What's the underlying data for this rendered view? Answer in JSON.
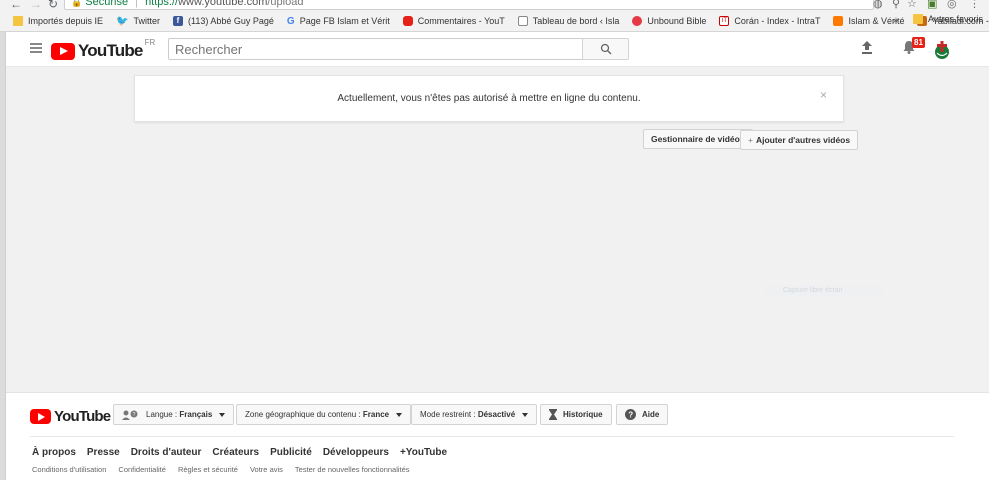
{
  "browser": {
    "secure_label": "Sécurisé",
    "url_scheme": "https://",
    "url_host": "www.youtube.com",
    "url_path": "/upload",
    "back_icon": "arrow-left-icon",
    "forward_icon": "arrow-right-icon",
    "reload_icon": "reload-icon"
  },
  "bookmarks": {
    "items": [
      {
        "label": "Importés depuis IE",
        "icon": "folder-icon"
      },
      {
        "label": "Twitter",
        "icon": "twitter-icon"
      },
      {
        "label": "(113) Abbé Guy Pagé",
        "icon": "facebook-icon"
      },
      {
        "label": "Page FB Islam et Vérit",
        "icon": "google-icon"
      },
      {
        "label": "Commentaires - YouT",
        "icon": "youtube-icon"
      },
      {
        "label": "Tableau de bord ‹ Isla",
        "icon": "page-icon"
      },
      {
        "label": "Unbound Bible",
        "icon": "unbound-bible-icon"
      },
      {
        "label": "Corán - Index - IntraT",
        "icon": "coran-icon"
      },
      {
        "label": "Islam & Vérité",
        "icon": "orange-icon"
      },
      {
        "label": "Yabiladi.com - Le Ma",
        "icon": "yabiladi-icon"
      }
    ],
    "more": "»",
    "others": "Autres favoris"
  },
  "masthead": {
    "logo_text": "YouTube",
    "country": "FR",
    "search_placeholder": "Rechercher",
    "notification_count": "81"
  },
  "main": {
    "alert_text": "Actuellement, vous n'êtes pas autorisé à mettre en ligne du contenu.",
    "alert_close": "×",
    "video_manager": "Gestionnaire de vidéos",
    "add_videos_plus": "+",
    "add_videos": "Ajouter d'autres vidéos",
    "faint_label": "Capture libre écran"
  },
  "footer": {
    "logo_text": "YouTube",
    "language_label": "Langue :",
    "language_value": "Français",
    "zone_label": "Zone géographique du contenu :",
    "zone_value": "France",
    "restricted_label": "Mode restreint :",
    "restricted_value": "Désactivé",
    "history": "Historique",
    "help": "Aide",
    "links": [
      "À propos",
      "Presse",
      "Droits d'auteur",
      "Créateurs",
      "Publicité",
      "Développeurs",
      "+YouTube"
    ],
    "sublinks": [
      "Conditions d'utilisation",
      "Confidentialité",
      "Règles et sécurité",
      "Votre avis",
      "Tester de nouvelles fonctionnalités"
    ]
  },
  "colors": {
    "brand_red": "#ff0000",
    "badge_red": "#e62117",
    "secure_green": "#0b8043"
  }
}
